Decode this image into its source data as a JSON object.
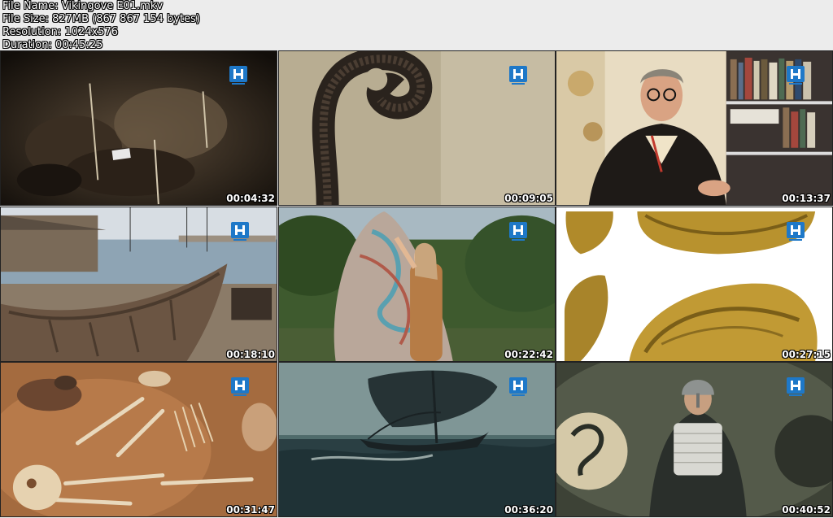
{
  "file_info": {
    "file_name": "File Name: Vikingove E01.mkv",
    "file_size": "File Size: 827MB (867 867 154 bytes)",
    "resolution": "Resolution: 1024x576",
    "duration": "Duration: 00:45:25"
  },
  "thumbnails": [
    {
      "timestamp": "00:04:32",
      "scene": "excavation-soil"
    },
    {
      "timestamp": "00:09:05",
      "scene": "carved-ship-prow"
    },
    {
      "timestamp": "00:13:37",
      "scene": "interview-professor"
    },
    {
      "timestamp": "00:18:10",
      "scene": "viking-boat-harbor"
    },
    {
      "timestamp": "00:22:42",
      "scene": "rune-stone"
    },
    {
      "timestamp": "00:27:15",
      "scene": "gold-brooch"
    },
    {
      "timestamp": "00:31:47",
      "scene": "skeleton-grave"
    },
    {
      "timestamp": "00:36:20",
      "scene": "longship-sea"
    },
    {
      "timestamp": "00:40:52",
      "scene": "viking-warrior"
    }
  ],
  "colors": {
    "logo": "#1e78c8",
    "background": "#ececec"
  }
}
